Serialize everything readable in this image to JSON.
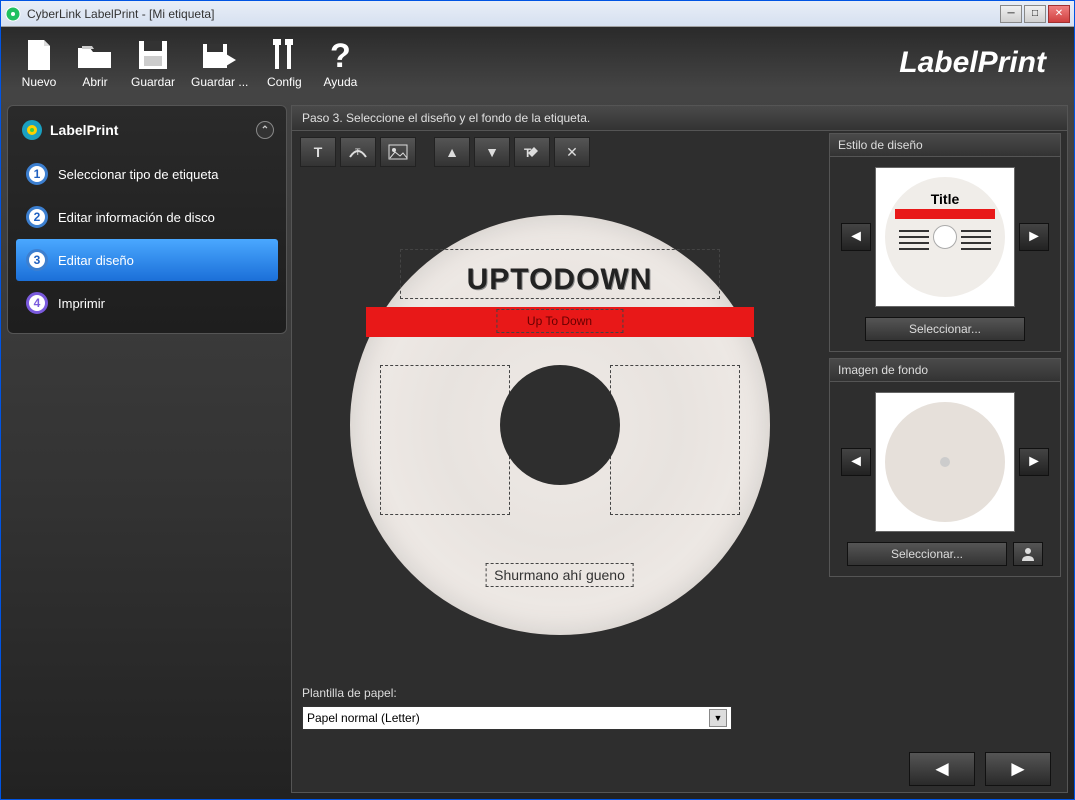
{
  "window": {
    "title": "CyberLink LabelPrint - [Mi etiqueta]"
  },
  "toolbar": {
    "nuevo": "Nuevo",
    "abrir": "Abrir",
    "guardar": "Guardar",
    "guardar_como": "Guardar ...",
    "config": "Config",
    "ayuda": "Ayuda",
    "brand": "LabelPrint"
  },
  "sidebar": {
    "title": "LabelPrint",
    "steps": {
      "s1": {
        "num": "1",
        "label": "Seleccionar tipo de etiqueta"
      },
      "s2": {
        "num": "2",
        "label": "Editar información de disco"
      },
      "s3": {
        "num": "3",
        "label": "Editar diseño"
      },
      "s4": {
        "num": "4",
        "label": "Imprimir"
      }
    }
  },
  "step_header": "Paso 3. Seleccione el diseño y el fondo de la etiqueta.",
  "disc": {
    "title": "UPTODOWN",
    "subtitle": "Up To Down",
    "footer": "Shurmano ahí gueno"
  },
  "template": {
    "label": "Plantilla de papel:",
    "value": "Papel normal (Letter)"
  },
  "design_panel": {
    "header": "Estilo de diseño",
    "preview_title": "Title",
    "select": "Seleccionar..."
  },
  "bg_panel": {
    "header": "Imagen de fondo",
    "select": "Seleccionar..."
  }
}
